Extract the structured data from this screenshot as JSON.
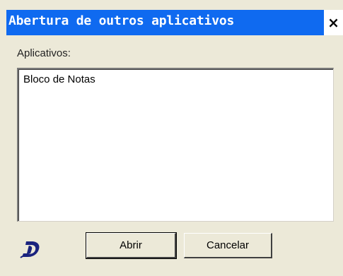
{
  "window": {
    "title": "Abertura de outros aplicativos",
    "close_glyph": "×",
    "close_icon": "close-icon"
  },
  "form": {
    "list_label": "Aplicativos:",
    "items": [
      "Bloco de Notas"
    ],
    "selected_index": null
  },
  "buttons": {
    "open_label": "Abrir",
    "cancel_label": "Cancelar"
  },
  "colors": {
    "title_bar": "#0f6af0",
    "title_text": "#ffffff",
    "dialog_bg": "#ece9d8",
    "logo": "#1a237e"
  },
  "logo_icon": "app-logo-d-icon"
}
